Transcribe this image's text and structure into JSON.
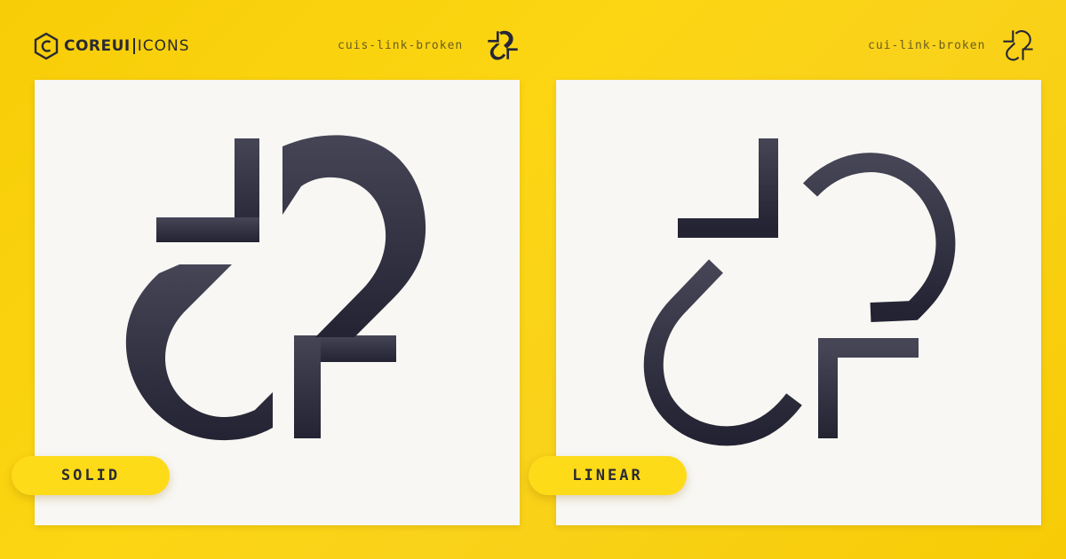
{
  "brand": {
    "logo_core": "COREUI",
    "logo_icons": "ICONS"
  },
  "variants": {
    "solid": {
      "icon_name": "cuis-link-broken",
      "badge": "SOLID"
    },
    "linear": {
      "icon_name": "cui-link-broken",
      "badge": "LINEAR"
    }
  },
  "colors": {
    "background": "#f9d21a",
    "card": "#f8f7f3",
    "icon_dark": "#262636",
    "icon_top": "#454556",
    "pill": "#fedb18"
  },
  "icons": {
    "logo": "coreui-hexagon-logo-icon",
    "glyph": "link-broken-icon"
  }
}
